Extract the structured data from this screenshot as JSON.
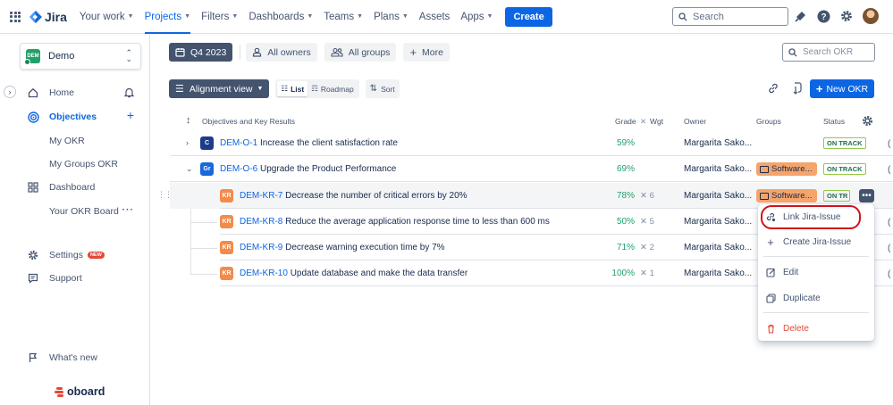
{
  "topbar": {
    "app_name": "Jira",
    "nav": [
      {
        "label": "Your work",
        "active": false
      },
      {
        "label": "Projects",
        "active": true
      },
      {
        "label": "Filters",
        "active": false
      },
      {
        "label": "Dashboards",
        "active": false
      },
      {
        "label": "Teams",
        "active": false
      },
      {
        "label": "Plans",
        "active": false
      },
      {
        "label": "Assets",
        "active": false,
        "no_chevron": true
      },
      {
        "label": "Apps",
        "active": false
      }
    ],
    "create_label": "Create",
    "search_placeholder": "Search",
    "icons": [
      "notifications-icon",
      "help-icon",
      "settings-icon",
      "profile-avatar"
    ],
    "accent": "#0c66e4"
  },
  "sidebar": {
    "project_name": "Demo",
    "project_badge": "DEM",
    "items": [
      {
        "label": "Home",
        "icon": "home-icon",
        "right": "bell-icon"
      },
      {
        "label": "Objectives",
        "icon": "target-icon",
        "right": "plus-icon",
        "active": true
      },
      {
        "label": "My OKR",
        "sub": true
      },
      {
        "label": "My Groups OKR",
        "sub": true
      },
      {
        "label": "Dashboard",
        "icon": "dashboard-icon"
      },
      {
        "label": "Your OKR Board",
        "sub": true,
        "right": "more-icon"
      },
      {
        "label": "Settings",
        "icon": "settings-icon",
        "badge": "NEW"
      },
      {
        "label": "Support",
        "icon": "support-icon"
      },
      {
        "label": "What's new",
        "icon": "flag-icon"
      }
    ],
    "brand": "oboard"
  },
  "filters": {
    "period": "Q4 2023",
    "owners": "All owners",
    "groups": "All groups",
    "more": "More",
    "search_placeholder": "Search OKR"
  },
  "view": {
    "alignment": "Alignment view",
    "list": "List",
    "roadmap": "Roadmap",
    "sort": "Sort",
    "new_okr": "New OKR"
  },
  "table": {
    "headers": {
      "title": "Objectives and Key Results",
      "grade": "Grade",
      "weight": "Wgt",
      "owner": "Owner",
      "groups": "Groups",
      "status": "Status"
    },
    "rows": [
      {
        "level": 0,
        "badge": "C",
        "badge_color": "#1d3b8b",
        "key": "DEM-O-1",
        "name": "Increase the client satisfaction rate",
        "grade": "59%",
        "weight": "",
        "owner": "Margarita Sako...",
        "group": "",
        "status": "ON TRACK",
        "chevron": "›"
      },
      {
        "level": 0,
        "badge": "Gr",
        "badge_color": "#1868db",
        "key": "DEM-O-6",
        "name": "Upgrade the Product Performance",
        "grade": "69%",
        "weight": "",
        "owner": "Margarita Sako...",
        "group": "Software...",
        "status": "ON TRACK",
        "chevron": "⌄"
      },
      {
        "level": 1,
        "badge": "KR",
        "badge_color": "#f38b4b",
        "key": "DEM-KR-7",
        "name": "Decrease the number of critical errors by 20%",
        "grade": "78%",
        "weight": "6",
        "owner": "Margarita Sako...",
        "group": "Software...",
        "status": "ON TR",
        "highlight": true
      },
      {
        "level": 1,
        "badge": "KR",
        "badge_color": "#f38b4b",
        "key": "DEM-KR-8",
        "name": "Reduce the average application response time to less than 600 ms",
        "grade": "50%",
        "weight": "5",
        "owner": "Margarita Sako...",
        "group": "",
        "status": ""
      },
      {
        "level": 1,
        "badge": "KR",
        "badge_color": "#f38b4b",
        "key": "DEM-KR-9",
        "name": "Decrease warning execution time by 7%",
        "grade": "71%",
        "weight": "2",
        "owner": "Margarita Sako...",
        "group": "",
        "status": ""
      },
      {
        "level": 1,
        "badge": "KR",
        "badge_color": "#f38b4b",
        "key": "DEM-KR-10",
        "name": "Update database and make the data transfer",
        "grade": "100%",
        "weight": "1",
        "owner": "Margarita Sako...",
        "group": "",
        "status": ""
      }
    ]
  },
  "context_menu": {
    "items": [
      {
        "label": "Link Jira-Issue",
        "icon": "link-icon"
      },
      {
        "label": "Create Jira-Issue",
        "icon": "create-issue-icon"
      },
      {
        "label": "Edit",
        "icon": "edit-icon"
      },
      {
        "label": "Duplicate",
        "icon": "duplicate-icon"
      },
      {
        "label": "Delete",
        "icon": "trash-icon",
        "danger": true
      }
    ],
    "highlighted": "Link Jira-Issue",
    "highlight_color": "#d0121b"
  }
}
